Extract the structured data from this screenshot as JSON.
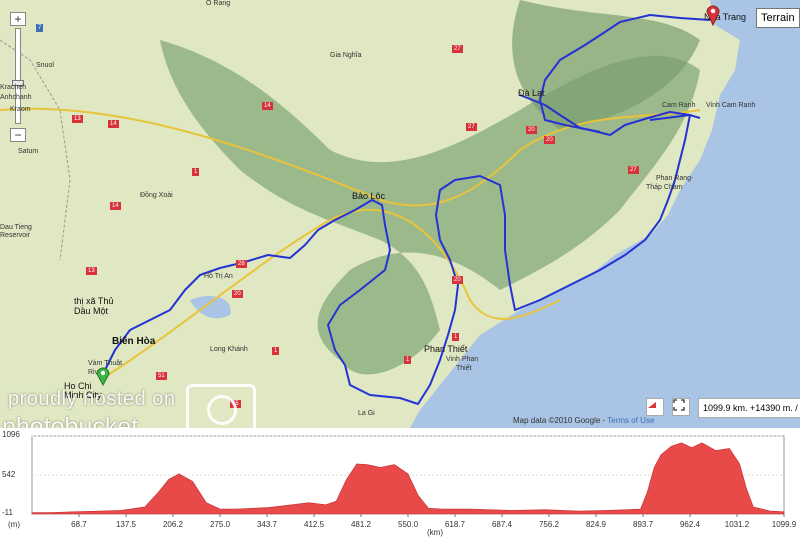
{
  "map": {
    "terrain_button": "Terrain",
    "zoom_in": "+",
    "zoom_out": "−",
    "credit": "Map data ©2010  Google - ",
    "credit_terms": "Terms of Use",
    "stats": "1099.9 km.  +14390 m. / -14",
    "labels": {
      "o_rang": "O Rang",
      "snuol": "Snuol",
      "kraoh": "Kracheh",
      "anhchanh": "Anhchanh",
      "kraom": "Kraom",
      "satum": "Satum",
      "gia_nghia": "Gia Nghĩa",
      "da_lat": "Đà Lạt",
      "nha_trang": "Nha Trang",
      "cam_ranh": "Cam Ranh",
      "vinh_cam_ranh": "Vinh Cam Ranh",
      "phan_rang": "Phan Rang-",
      "thap_cham": "Tháp Chàm",
      "bao_loc": "Bảo Lộc",
      "dong_xoai": "Đồng Xoài",
      "dau_tieng": "Dau Tieng",
      "reservoir": "Reservoir",
      "ho_tri_an": "Hồ Trị An",
      "thi_xa_thu": "thị xã Thủ",
      "dau_mot": "Dầu Một",
      "bien_hoa": "Biên Hòa",
      "long_khanh": "Long Khánh",
      "vam_thuat": "Vàm Thuật",
      "river": "River",
      "ho_chi": "Ho Chi",
      "minh_city": "Minh City",
      "phan_thiet": "Phan Thiết",
      "vinh_phan": "Vinh Phan",
      "thiet": "Thiết",
      "la_gi": "La Gi"
    },
    "shields": [
      "7",
      "13",
      "14",
      "14",
      "13",
      "27",
      "27",
      "20",
      "20",
      "27",
      "14",
      "1",
      "1",
      "1",
      "20",
      "20",
      "1",
      "51",
      "55",
      "28"
    ],
    "colors": {
      "route": "#2532d4",
      "land": "#dfe8c2",
      "sea": "#a9c4e4",
      "forest": "#86a978",
      "road": "#e8c43a",
      "marker_start": "#3cb643",
      "marker_end": "#d9343a"
    }
  },
  "watermark": {
    "line1": "proudly hosted on",
    "line2": "photobucket"
  },
  "profile": {
    "y_labels": [
      "1096",
      "542",
      "-11"
    ],
    "y_unit": "(m)",
    "x_unit": "(km)",
    "fill_color": "#e84a4a"
  },
  "chart_data": {
    "type": "area",
    "title": "",
    "xlabel": "(km)",
    "ylabel": "(m)",
    "xlim": [
      0,
      1099.9
    ],
    "ylim": [
      -11,
      1096
    ],
    "x_ticks": [
      "68.7",
      "137.5",
      "206.2",
      "275.0",
      "343.7",
      "412.5",
      "481.2",
      "550.0",
      "618.7",
      "687.4",
      "756.2",
      "824.9",
      "893.7",
      "962.4",
      "1031.2",
      "1099.9"
    ],
    "y_ticks": [
      "1096",
      "542",
      "-11"
    ],
    "x": [
      0,
      30,
      60,
      100,
      130,
      165,
      185,
      200,
      215,
      235,
      255,
      275,
      300,
      345,
      380,
      405,
      430,
      445,
      460,
      475,
      490,
      510,
      530,
      550,
      565,
      580,
      600,
      640,
      700,
      750,
      800,
      840,
      870,
      890,
      900,
      910,
      920,
      935,
      950,
      965,
      980,
      1000,
      1020,
      1035,
      1045,
      1055,
      1080,
      1099.9
    ],
    "y": [
      10,
      10,
      20,
      30,
      40,
      90,
      300,
      480,
      560,
      450,
      150,
      60,
      60,
      80,
      120,
      150,
      120,
      170,
      480,
      700,
      690,
      650,
      690,
      560,
      250,
      70,
      60,
      60,
      40,
      50,
      30,
      40,
      50,
      60,
      300,
      650,
      830,
      950,
      1000,
      930,
      1000,
      890,
      920,
      700,
      350,
      90,
      30,
      20
    ]
  }
}
